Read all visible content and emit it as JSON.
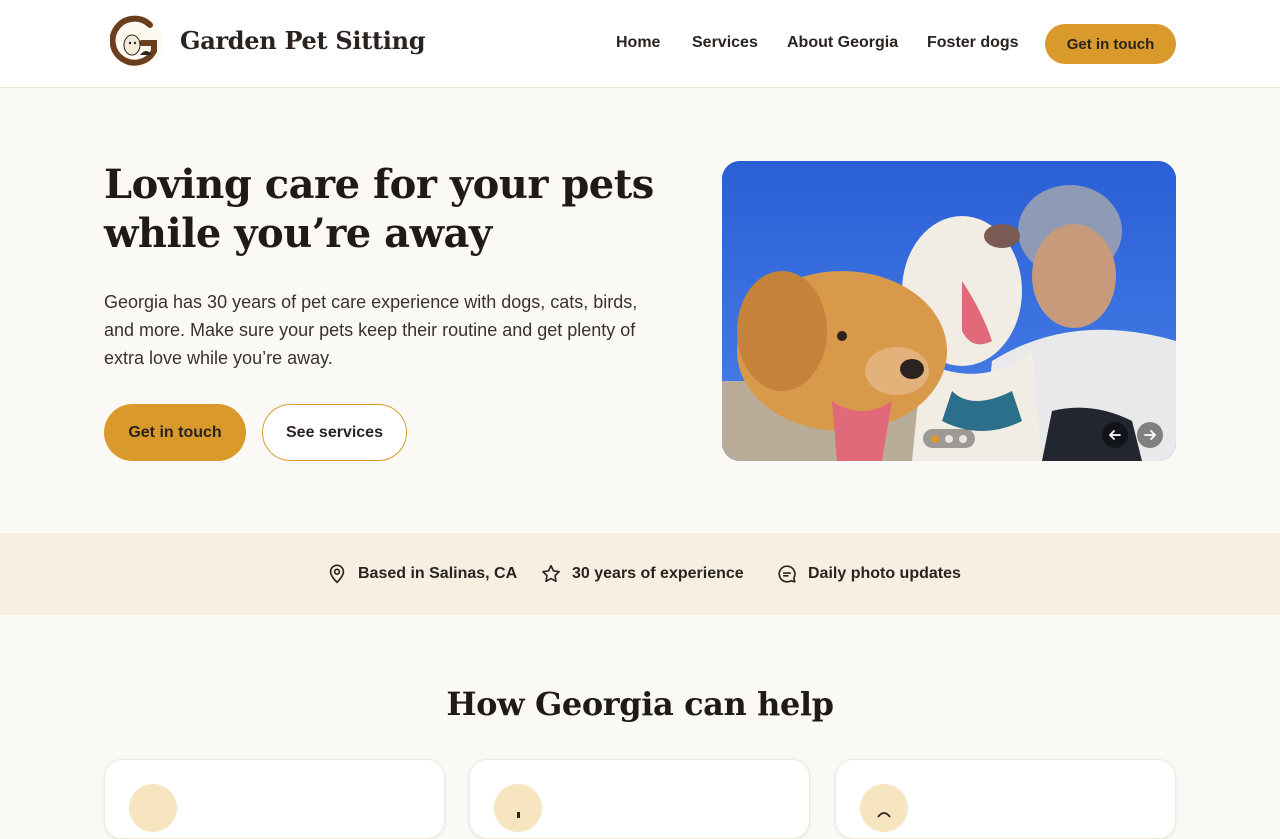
{
  "header": {
    "brand": "Garden Pet Sitting",
    "nav": [
      {
        "label": "Home"
      },
      {
        "label": "Services"
      },
      {
        "label": "About Georgia"
      },
      {
        "label": "Foster dogs"
      }
    ],
    "cta_label": "Get in touch"
  },
  "hero": {
    "title": "Loving care for your pets while you’re away",
    "description": "Georgia has 30 years of pet care experience with dogs, cats, birds, and more. Make sure your pets keep their routine and get plenty of extra love while you’re away.",
    "primary_label": "Get in touch",
    "secondary_label": "See services",
    "carousel": {
      "slide_count": 3,
      "active_slide": 1,
      "prev_icon": "arrow-left-icon",
      "next_icon": "arrow-right-icon"
    }
  },
  "features": [
    {
      "icon": "location-pin-icon",
      "label": "Based in Salinas, CA"
    },
    {
      "icon": "star-icon",
      "label": "30 years of experience"
    },
    {
      "icon": "chat-bubble-icon",
      "label": "Daily photo updates"
    }
  ],
  "help": {
    "title": "How Georgia can help",
    "cards": [
      {
        "icon": "service-icon-1"
      },
      {
        "icon": "service-icon-2"
      },
      {
        "icon": "service-icon-3"
      }
    ]
  },
  "colors": {
    "accent": "#d99a2b",
    "page_bg": "#fbf9f5",
    "strip_bg": "#f8efe3",
    "text": "#1f1a17"
  }
}
